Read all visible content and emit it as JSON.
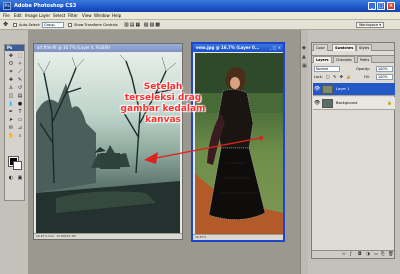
{
  "app": {
    "title": "Adobe Photoshop CS3",
    "logo_text": "Ps",
    "window_buttons": {
      "minimize": "_",
      "maximize": "□",
      "close": "×"
    }
  },
  "menu": [
    "File",
    "Edit",
    "Image",
    "Layer",
    "Select",
    "Filter",
    "View",
    "Window",
    "Help"
  ],
  "options_bar": {
    "auto_select_label": "Auto-Select:",
    "auto_select_value": "Group",
    "show_transform_label": "Show Transform Controls",
    "workspace_label": "Workspace ▾"
  },
  "toolbox": {
    "header": "Ps"
  },
  "documents": [
    {
      "title": "art film-III @ 16.7% (Layer 4, RGB/8)",
      "status": "16.67%   Doc: 15.6M/25.3M"
    },
    {
      "title": "emo.jpg @ 16.7% (Layer 0...",
      "status": "16.67%"
    }
  ],
  "annotation": {
    "line1": "Setelah",
    "line2": "terseleksi drag",
    "line3": "gambar kedalam",
    "line4": "kanvas",
    "color": "#ff2d2d"
  },
  "panel": {
    "tabs": [
      "Layers",
      "Channels",
      "Paths"
    ],
    "blend_mode": "Normal",
    "opacity_label": "Opacity:",
    "opacity_value": "100%",
    "lock_label": "Lock:",
    "fill_label": "Fill:",
    "fill_value": "100%",
    "layers": [
      {
        "name": "Layer 1",
        "selected": true
      },
      {
        "name": "Background",
        "selected": false
      }
    ],
    "top_tabs": [
      "Color",
      "Swatches",
      "Styles"
    ]
  },
  "colors": {
    "titlebar": "#1d55c9",
    "active_doc_border": "#1e46c8",
    "selected_layer": "#2458c6"
  }
}
